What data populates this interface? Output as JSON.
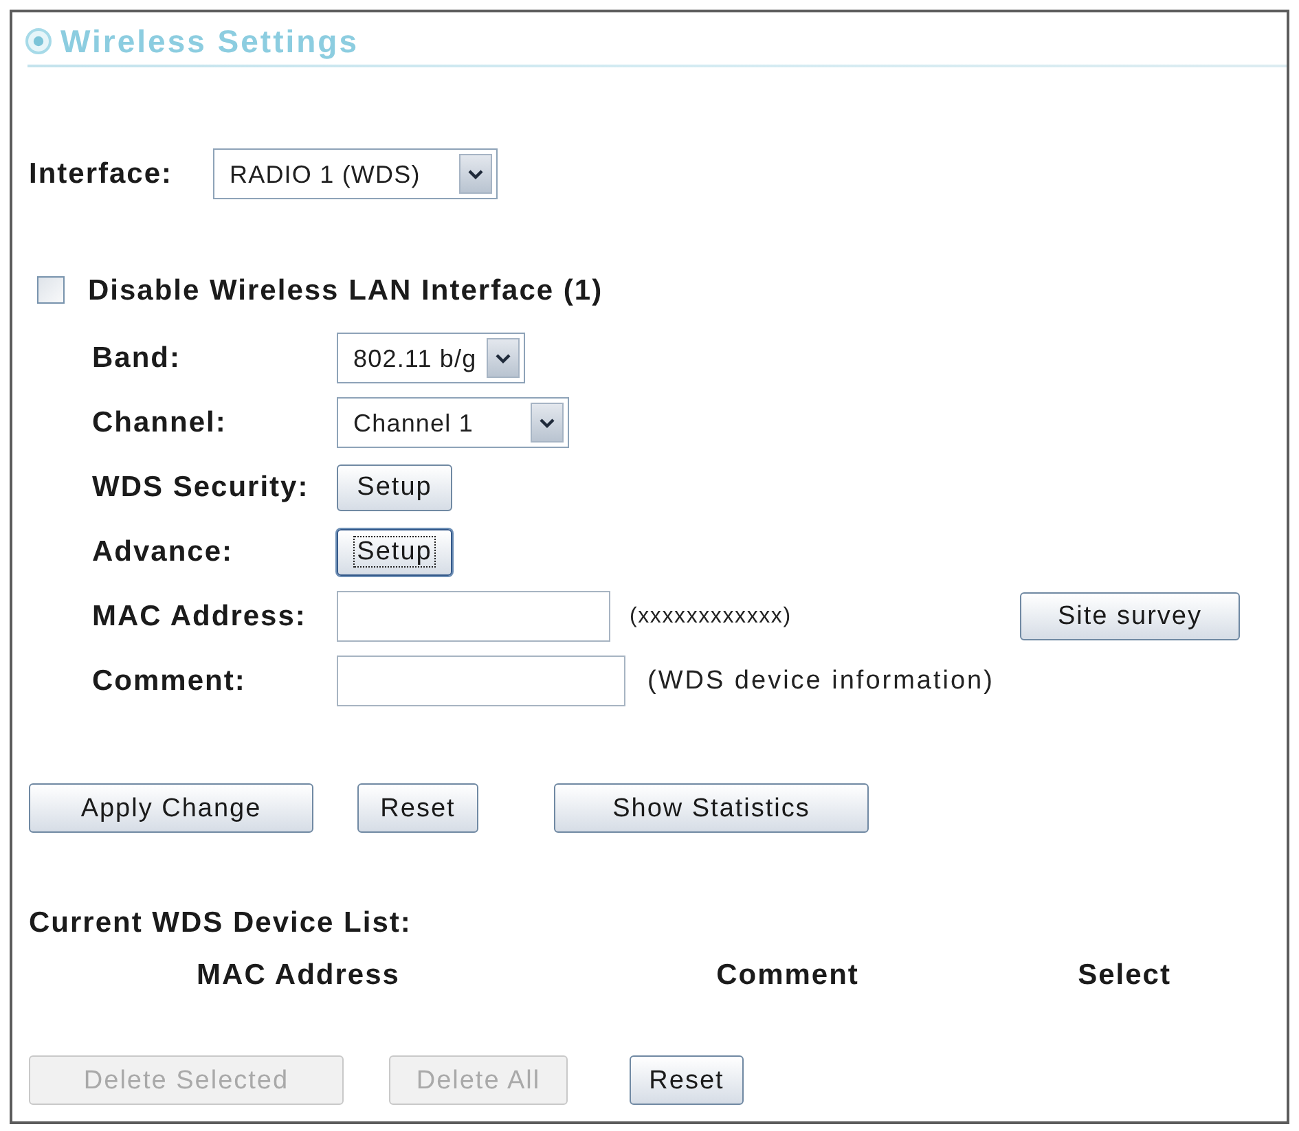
{
  "header": {
    "title": "Wireless Settings"
  },
  "interface": {
    "label": "Interface:",
    "value": "RADIO 1 (WDS)"
  },
  "disable_wlan": {
    "label": "Disable Wireless LAN Interface (1)",
    "checked": false
  },
  "fields": [
    {
      "kind": "select",
      "label": "Band:",
      "value": "802.11 b/g"
    },
    {
      "kind": "select",
      "label": "Channel:",
      "value": "Channel 1"
    },
    {
      "kind": "button",
      "label": "WDS Security:",
      "button": "Setup",
      "focused": false
    },
    {
      "kind": "button",
      "label": "Advance:",
      "button": "Setup",
      "focused": true
    },
    {
      "kind": "input",
      "label": "MAC Address:",
      "hint": "(xxxxxxxxxxxx)",
      "button": "Site survey"
    },
    {
      "kind": "input",
      "label": "Comment:",
      "hint": "(WDS device information)"
    }
  ],
  "actions": [
    {
      "label": "Apply Change"
    },
    {
      "label": "Reset"
    },
    {
      "label": "Show Statistics"
    }
  ],
  "device_list": {
    "title": "Current WDS Device List:",
    "columns": [
      "MAC Address",
      "Comment",
      "Select"
    ]
  },
  "list_actions": [
    {
      "label": "Delete Selected",
      "disabled": true
    },
    {
      "label": "Delete All",
      "disabled": true
    },
    {
      "label": "Reset",
      "disabled": false
    }
  ]
}
